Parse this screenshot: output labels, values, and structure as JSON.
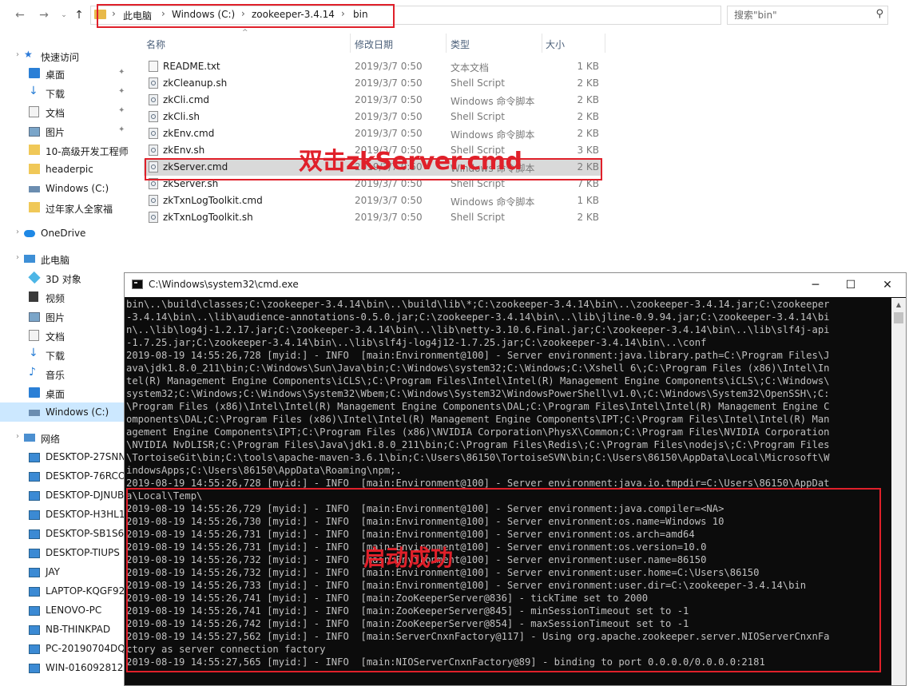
{
  "explorer": {
    "breadcrumb": [
      "此电脑",
      "Windows (C:)",
      "zookeeper-3.4.14",
      "bin"
    ],
    "search_placeholder": "搜索\"bin\"",
    "icons": {
      "back": "arrow-left-icon",
      "forward": "arrow-right-icon",
      "recent": "chevron-down-icon",
      "up": "arrow-up-icon",
      "refresh": "refresh-icon",
      "search": "search-icon"
    },
    "columns": {
      "name": "名称",
      "modified": "修改日期",
      "type": "类型",
      "size": "大小"
    },
    "files": [
      {
        "name": "README.txt",
        "modified": "2019/3/7 0:50",
        "type": "文本文档",
        "size": "1 KB",
        "icon": "text-file-icon"
      },
      {
        "name": "zkCleanup.sh",
        "modified": "2019/3/7 0:50",
        "type": "Shell Script",
        "size": "2 KB",
        "icon": "script-file-icon"
      },
      {
        "name": "zkCli.cmd",
        "modified": "2019/3/7 0:50",
        "type": "Windows 命令脚本",
        "size": "2 KB",
        "icon": "script-file-icon"
      },
      {
        "name": "zkCli.sh",
        "modified": "2019/3/7 0:50",
        "type": "Shell Script",
        "size": "2 KB",
        "icon": "script-file-icon"
      },
      {
        "name": "zkEnv.cmd",
        "modified": "2019/3/7 0:50",
        "type": "Windows 命令脚本",
        "size": "2 KB",
        "icon": "script-file-icon"
      },
      {
        "name": "zkEnv.sh",
        "modified": "2019/3/7 0:50",
        "type": "Shell Script",
        "size": "3 KB",
        "icon": "script-file-icon"
      },
      {
        "name": "zkServer.cmd",
        "modified": "2019/3/7 0:50",
        "type": "Windows 命令脚本",
        "size": "2 KB",
        "icon": "script-file-icon",
        "selected": true
      },
      {
        "name": "zkServer.sh",
        "modified": "2019/3/7 0:50",
        "type": "Shell Script",
        "size": "7 KB",
        "icon": "script-file-icon"
      },
      {
        "name": "zkTxnLogToolkit.cmd",
        "modified": "2019/3/7 0:50",
        "type": "Windows 命令脚本",
        "size": "1 KB",
        "icon": "script-file-icon"
      },
      {
        "name": "zkTxnLogToolkit.sh",
        "modified": "2019/3/7 0:50",
        "type": "Shell Script",
        "size": "2 KB",
        "icon": "script-file-icon"
      }
    ],
    "nav_pane": [
      {
        "label": "快速访问",
        "icon": "star-icon"
      },
      {
        "label": "桌面",
        "icon": "desktop-icon",
        "pinned": true
      },
      {
        "label": "下载",
        "icon": "download-icon",
        "pinned": true
      },
      {
        "label": "文档",
        "icon": "document-icon",
        "pinned": true
      },
      {
        "label": "图片",
        "icon": "picture-icon",
        "pinned": true
      },
      {
        "label": "10-高级开发工程师",
        "icon": "folder-icon"
      },
      {
        "label": "headerpic",
        "icon": "folder-icon"
      },
      {
        "label": "Windows (C:)",
        "icon": "drive-icon"
      },
      {
        "label": "过年家人全家福",
        "icon": "folder-icon"
      },
      {
        "label": "OneDrive",
        "icon": "cloud-icon"
      },
      {
        "label": "此电脑",
        "icon": "computer-icon"
      },
      {
        "label": "3D 对象",
        "icon": "3d-objects-icon"
      },
      {
        "label": "视频",
        "icon": "video-icon"
      },
      {
        "label": "图片",
        "icon": "picture-icon"
      },
      {
        "label": "文档",
        "icon": "document-icon"
      },
      {
        "label": "下载",
        "icon": "download-icon"
      },
      {
        "label": "音乐",
        "icon": "music-icon"
      },
      {
        "label": "桌面",
        "icon": "desktop-icon"
      },
      {
        "label": "Windows (C:)",
        "icon": "drive-icon",
        "selected": true
      },
      {
        "label": "网络",
        "icon": "network-icon"
      },
      {
        "label": "DESKTOP-27SNN",
        "icon": "monitor-icon"
      },
      {
        "label": "DESKTOP-76RCO",
        "icon": "monitor-icon"
      },
      {
        "label": "DESKTOP-DJNUB",
        "icon": "monitor-icon"
      },
      {
        "label": "DESKTOP-H3HL1",
        "icon": "monitor-icon"
      },
      {
        "label": "DESKTOP-SB1S6",
        "icon": "monitor-icon"
      },
      {
        "label": "DESKTOP-TIUPS",
        "icon": "monitor-icon"
      },
      {
        "label": "JAY",
        "icon": "monitor-icon"
      },
      {
        "label": "LAPTOP-KQGF92",
        "icon": "monitor-icon"
      },
      {
        "label": "LENOVO-PC",
        "icon": "monitor-icon"
      },
      {
        "label": "NB-THINKPAD",
        "icon": "monitor-icon"
      },
      {
        "label": "PC-20190704DQ",
        "icon": "monitor-icon"
      },
      {
        "label": "WIN-016092812",
        "icon": "monitor-icon"
      }
    ]
  },
  "annotations": {
    "double_click_label": "双击zkServer.cmd",
    "success_label": "启动成功",
    "color": "#e0202a"
  },
  "cmd": {
    "title": "C:\\Windows\\system32\\cmd.exe",
    "controls": {
      "minimize": "─",
      "maximize": "☐",
      "close": "✕"
    },
    "lines": [
      "bin\\..\\build\\classes;C:\\zookeeper-3.4.14\\bin\\..\\build\\lib\\*;C:\\zookeeper-3.4.14\\bin\\..\\zookeeper-3.4.14.jar;C:\\zookeeper",
      "-3.4.14\\bin\\..\\lib\\audience-annotations-0.5.0.jar;C:\\zookeeper-3.4.14\\bin\\..\\lib\\jline-0.9.94.jar;C:\\zookeeper-3.4.14\\bi",
      "n\\..\\lib\\log4j-1.2.17.jar;C:\\zookeeper-3.4.14\\bin\\..\\lib\\netty-3.10.6.Final.jar;C:\\zookeeper-3.4.14\\bin\\..\\lib\\slf4j-api",
      "-1.7.25.jar;C:\\zookeeper-3.4.14\\bin\\..\\lib\\slf4j-log4j12-1.7.25.jar;C:\\zookeeper-3.4.14\\bin\\..\\conf",
      "2019-08-19 14:55:26,728 [myid:] - INFO  [main:Environment@100] - Server environment:java.library.path=C:\\Program Files\\J",
      "ava\\jdk1.8.0_211\\bin;C:\\Windows\\Sun\\Java\\bin;C:\\Windows\\system32;C:\\Windows;C:\\Xshell 6\\;C:\\Program Files (x86)\\Intel\\In",
      "tel(R) Management Engine Components\\iCLS\\;C:\\Program Files\\Intel\\Intel(R) Management Engine Components\\iCLS\\;C:\\Windows\\",
      "system32;C:\\Windows;C:\\Windows\\System32\\Wbem;C:\\Windows\\System32\\WindowsPowerShell\\v1.0\\;C:\\Windows\\System32\\OpenSSH\\;C:",
      "\\Program Files (x86)\\Intel\\Intel(R) Management Engine Components\\DAL;C:\\Program Files\\Intel\\Intel(R) Management Engine C",
      "omponents\\DAL;C:\\Program Files (x86)\\Intel\\Intel(R) Management Engine Components\\IPT;C:\\Program Files\\Intel\\Intel(R) Man",
      "agement Engine Components\\IPT;C:\\Program Files (x86)\\NVIDIA Corporation\\PhysX\\Common;C:\\Program Files\\NVIDIA Corporation",
      "\\NVIDIA NvDLISR;C:\\Program Files\\Java\\jdk1.8.0_211\\bin;C:\\Program Files\\Redis\\;C:\\Program Files\\nodejs\\;C:\\Program Files",
      "\\TortoiseGit\\bin;C:\\tools\\apache-maven-3.6.1\\bin;C:\\Users\\86150\\TortoiseSVN\\bin;C:\\Users\\86150\\AppData\\Local\\Microsoft\\W",
      "indowsApps;C:\\Users\\86150\\AppData\\Roaming\\npm;.",
      "2019-08-19 14:55:26,728 [myid:] - INFO  [main:Environment@100] - Server environment:java.io.tmpdir=C:\\Users\\86150\\AppDat",
      "a\\Local\\Temp\\",
      "2019-08-19 14:55:26,729 [myid:] - INFO  [main:Environment@100] - Server environment:java.compiler=<NA>",
      "2019-08-19 14:55:26,730 [myid:] - INFO  [main:Environment@100] - Server environment:os.name=Windows 10",
      "2019-08-19 14:55:26,731 [myid:] - INFO  [main:Environment@100] - Server environment:os.arch=amd64",
      "2019-08-19 14:55:26,731 [myid:] - INFO  [main:Environment@100] - Server environment:os.version=10.0",
      "2019-08-19 14:55:26,732 [myid:] - INFO  [main:Environment@100] - Server environment:user.name=86150",
      "2019-08-19 14:55:26,732 [myid:] - INFO  [main:Environment@100] - Server environment:user.home=C:\\Users\\86150",
      "2019-08-19 14:55:26,733 [myid:] - INFO  [main:Environment@100] - Server environment:user.dir=C:\\zookeeper-3.4.14\\bin",
      "2019-08-19 14:55:26,741 [myid:] - INFO  [main:ZooKeeperServer@836] - tickTime set to 2000",
      "2019-08-19 14:55:26,741 [myid:] - INFO  [main:ZooKeeperServer@845] - minSessionTimeout set to -1",
      "2019-08-19 14:55:26,742 [myid:] - INFO  [main:ZooKeeperServer@854] - maxSessionTimeout set to -1",
      "2019-08-19 14:55:27,562 [myid:] - INFO  [main:ServerCnxnFactory@117] - Using org.apache.zookeeper.server.NIOServerCnxnFa",
      "ctory as server connection factory",
      "2019-08-19 14:55:27,565 [myid:] - INFO  [main:NIOServerCnxnFactory@89] - binding to port 0.0.0.0/0.0.0.0:2181"
    ]
  }
}
